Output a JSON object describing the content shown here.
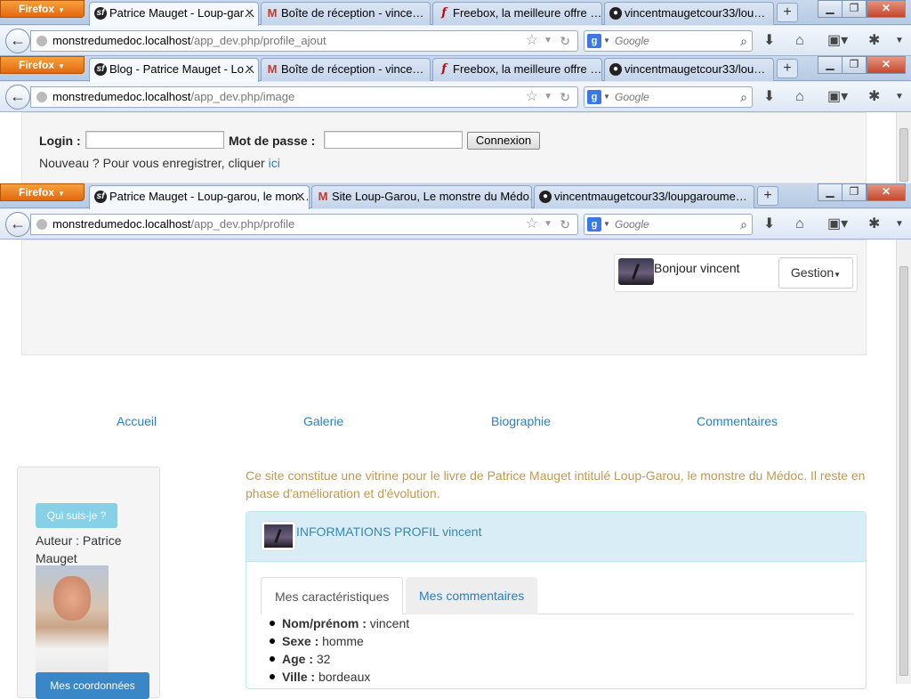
{
  "windows": [
    {
      "firefox_label": "Firefox",
      "tabs": [
        {
          "label": "Patrice Mauget - Loup-gar…",
          "icon": "symfony-icon"
        },
        {
          "label": "Boîte de réception - vince…",
          "icon": "gmail-icon"
        },
        {
          "label": "Freebox, la meilleure offre …",
          "icon": "freebox-icon"
        },
        {
          "label": "vincentmaugetcour33/lou…",
          "icon": "github-icon"
        }
      ],
      "url_host": "monstredumedoc.localhost",
      "url_path": "/app_dev.php/profile_ajout",
      "search_placeholder": "Google"
    },
    {
      "firefox_label": "Firefox",
      "tabs": [
        {
          "label": "Blog - Patrice Mauget - Lo…",
          "icon": "symfony-icon"
        },
        {
          "label": "Boîte de réception - vince…",
          "icon": "gmail-icon"
        },
        {
          "label": "Freebox, la meilleure offre …",
          "icon": "freebox-icon"
        },
        {
          "label": "vincentmaugetcour33/lou…",
          "icon": "github-icon"
        }
      ],
      "url_host": "monstredumedoc.localhost",
      "url_path": "/app_dev.php/image",
      "search_placeholder": "Google"
    },
    {
      "firefox_label": "Firefox",
      "tabs": [
        {
          "label": "Patrice Mauget - Loup-garou, le mon…",
          "icon": "symfony-icon"
        },
        {
          "label": "Site Loup-Garou, Le monstre du Médo…",
          "icon": "gmail-icon"
        },
        {
          "label": "vincentmaugetcour33/loupgaroume…",
          "icon": "github-icon"
        }
      ],
      "url_host": "monstredumedoc.localhost",
      "url_path": "/app_dev.php/profile",
      "search_placeholder": "Google"
    }
  ],
  "login": {
    "login_label": "Login :",
    "password_label": "Mot de passe :",
    "submit": "Connexion",
    "register_text": "Nouveau ? Pour vous enregistrer, cliquer",
    "register_link": "ici"
  },
  "user": {
    "greeting": "Bonjour vincent",
    "menu": "Gestion"
  },
  "nav": [
    "Accueil",
    "Galerie",
    "Biographie",
    "Commentaires"
  ],
  "sidebar": {
    "button": "Qui suis-je ?",
    "author": "Auteur : Patrice Mauget",
    "contact_button": "Mes coordonnées"
  },
  "intro": "Ce site constitue une vitrine pour le livre de Patrice Mauget intitulé Loup-Garou, le monstre du Médoc. Il reste en phase d'amélioration et d'évolution.",
  "profile": {
    "title": "INFORMATIONS PROFIL vincent",
    "tabs": [
      "Mes caractéristiques",
      "Mes commentaires"
    ],
    "fields": [
      {
        "label": "Nom/prénom :",
        "value": "vincent"
      },
      {
        "label": "Sexe :",
        "value": "homme"
      },
      {
        "label": "Age :",
        "value": "32"
      },
      {
        "label": "Ville :",
        "value": "bordeaux"
      }
    ]
  }
}
